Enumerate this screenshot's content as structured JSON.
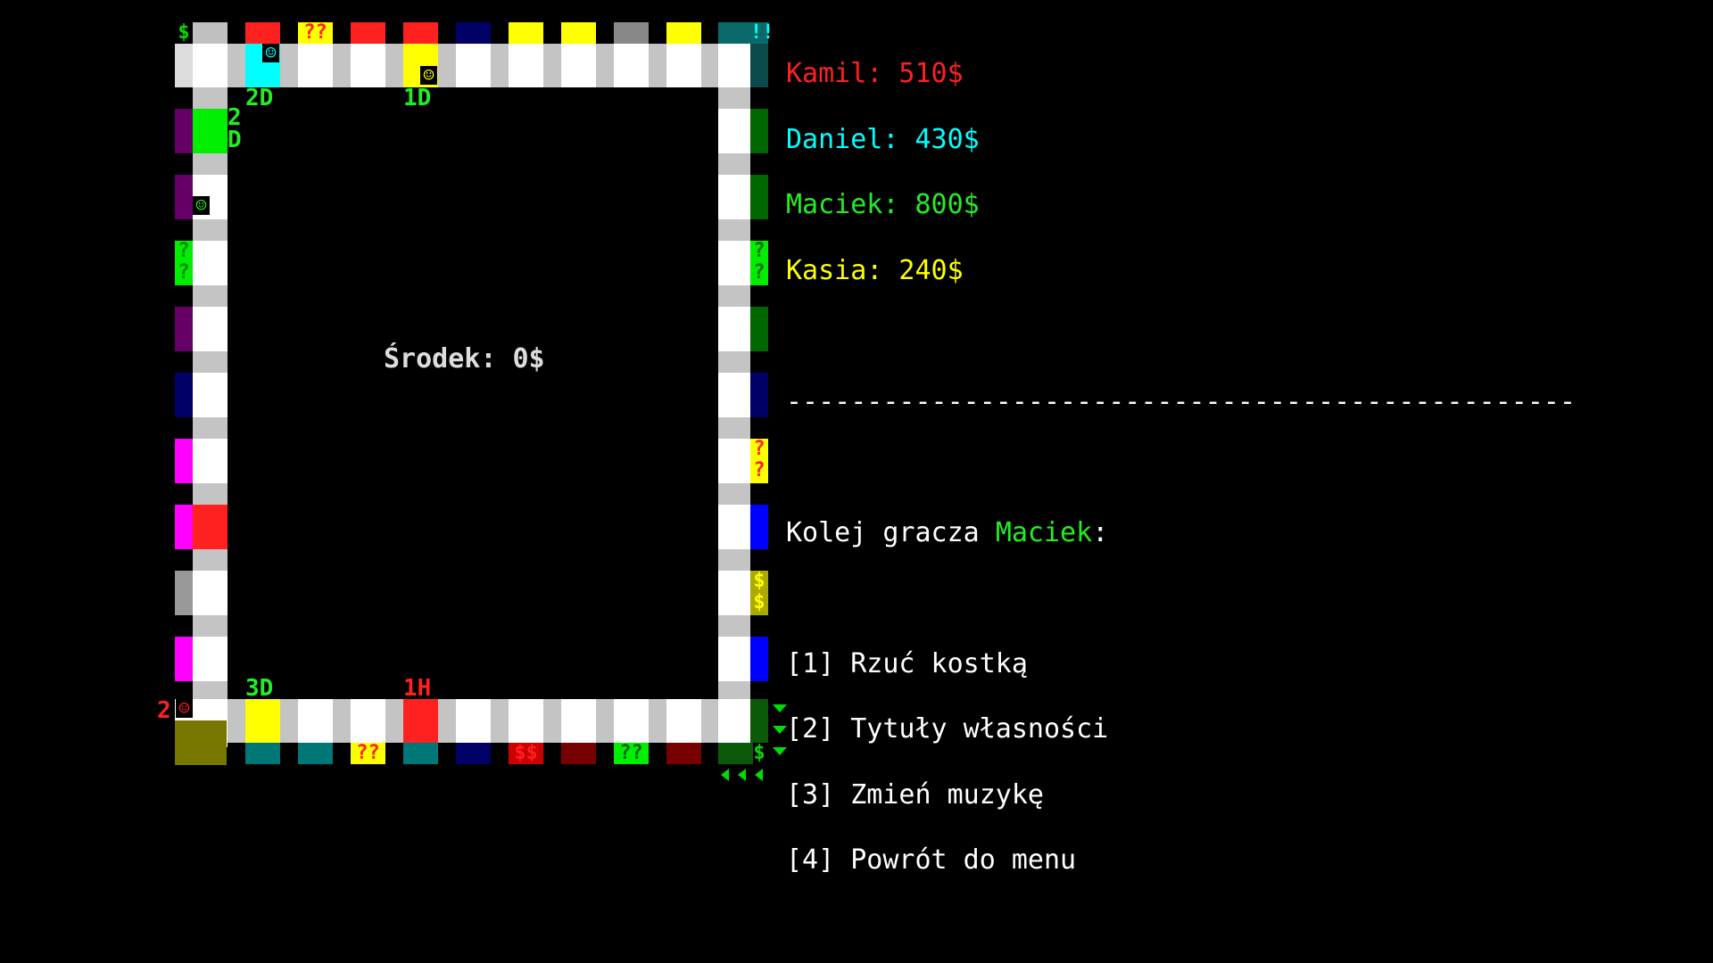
{
  "players": [
    {
      "label": "Kamil: 510$",
      "color": "#ff2020"
    },
    {
      "label": "Daniel: 430$",
      "color": "#00ffff"
    },
    {
      "label": "Maciek: 800$",
      "color": "#22ee22"
    },
    {
      "label": "Kasia: 240$",
      "color": "#ffff00"
    }
  ],
  "separator": "-------------------------------------------------",
  "turn": {
    "prefix": "Kolej gracza ",
    "player": "Maciek",
    "suffix": ":"
  },
  "menu": [
    "[1] Rzuć kostką",
    "[2] Tytuły własności",
    "[3] Zmień muzykę",
    "[4] Powrót do menu"
  ],
  "center_pot": "Środek: 0$",
  "board_markers": {
    "top_2d": "2D",
    "top_1d": "1D",
    "left_2d": "2\nD",
    "bottom_3d": "3D",
    "bottom_1h": "1H",
    "bottom_left_2": "2"
  },
  "glyphs": {
    "question": "??",
    "money": "$$",
    "exclaim": "!!",
    "dollar": "$",
    "smiley": "☺"
  }
}
